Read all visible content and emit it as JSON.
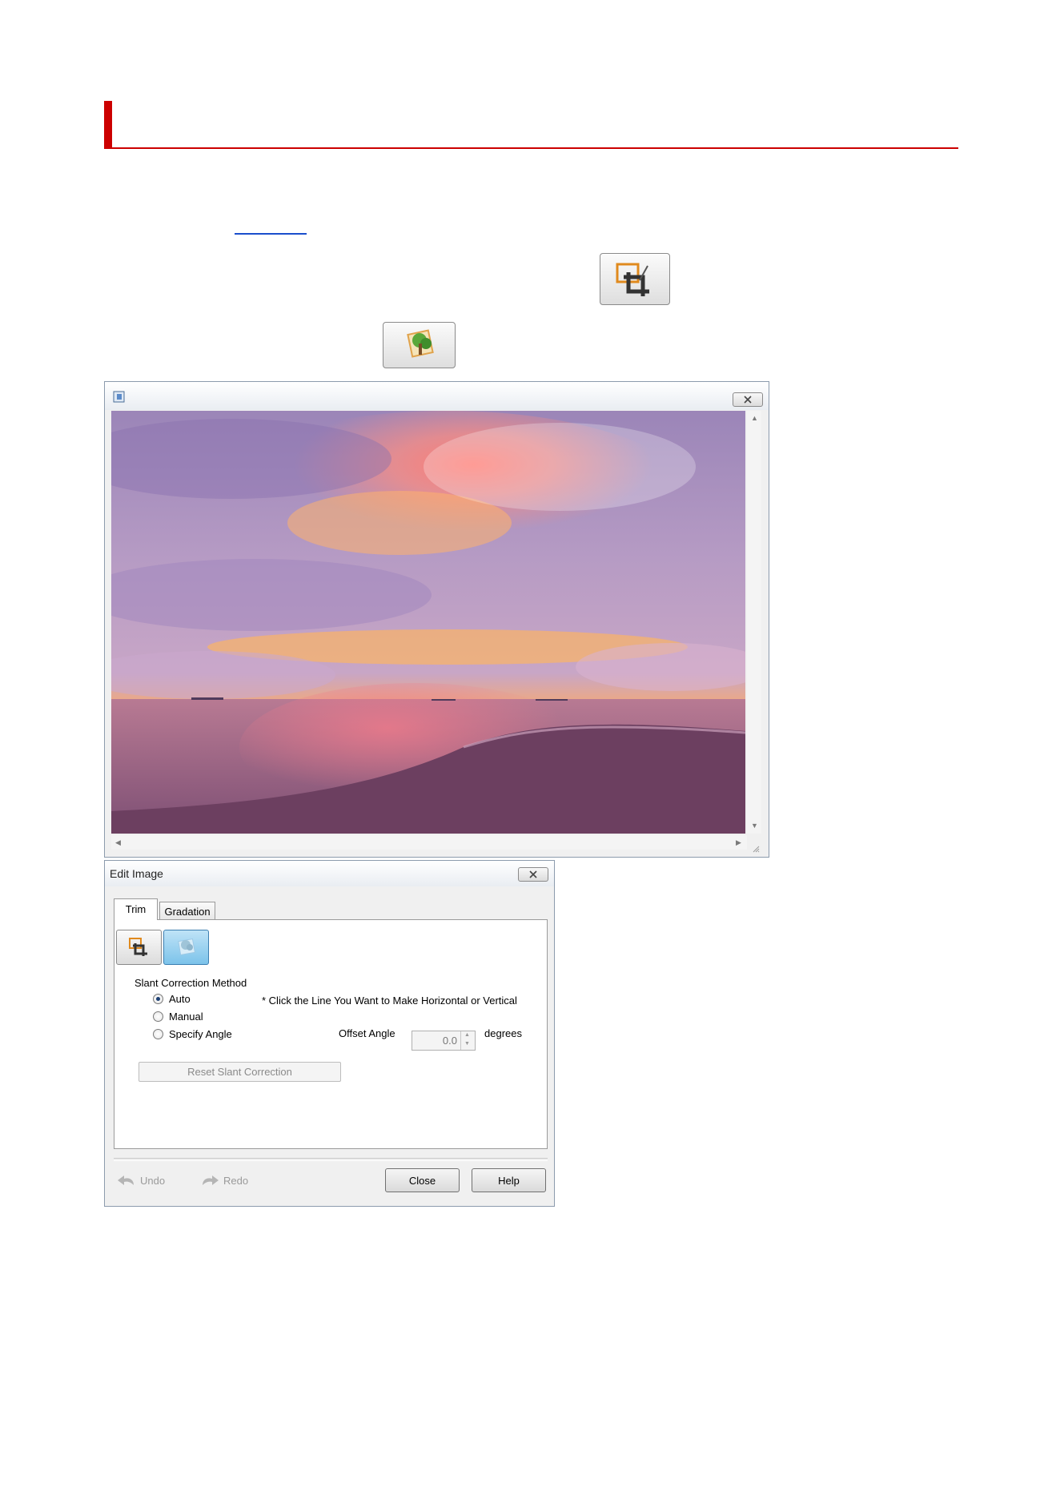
{
  "preview_window": {
    "close_icon": "close-icon",
    "title_icon": "app-window-icon"
  },
  "edit_image": {
    "title": "Edit Image",
    "tabs": [
      "Trim",
      "Gradation"
    ],
    "slant_section_label": "Slant Correction Method",
    "options": [
      "Auto",
      "Manual",
      "Specify Angle"
    ],
    "selected_option": "Auto",
    "hint": "* Click the Line You Want to Make Horizontal or Vertical",
    "offset_angle_label": "Offset Angle",
    "offset_angle_value": "0.0",
    "offset_angle_unit": "degrees",
    "reset_label": "Reset Slant Correction",
    "undo_label": "Undo",
    "redo_label": "Redo",
    "close_label": "Close",
    "help_label": "Help"
  },
  "colors": {
    "heading_accent": "#cc0000",
    "link": "#1a4ecc",
    "slant_button_active": "#7cc3ea"
  }
}
